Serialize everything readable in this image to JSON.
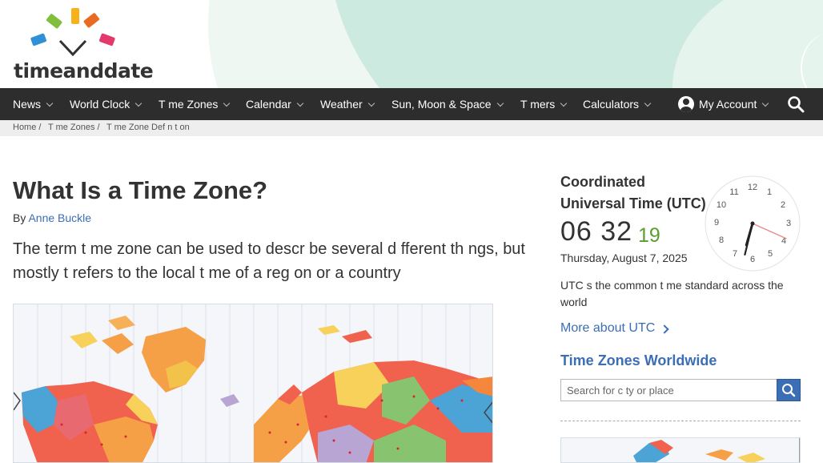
{
  "logo": {
    "text": "timeanddate",
    "colors": [
      "#f7b21b",
      "#e96a24",
      "#e33a6b",
      "#2f90d6",
      "#7fbf3c"
    ]
  },
  "nav": {
    "items": [
      {
        "label": "News"
      },
      {
        "label": "World Clock"
      },
      {
        "label": "T me Zones"
      },
      {
        "label": "Calendar"
      },
      {
        "label": "Weather"
      },
      {
        "label": "Sun, Moon & Space"
      },
      {
        "label": "T mers"
      },
      {
        "label": "Calculators"
      }
    ],
    "account": "My Account",
    "search_icon": "search-icon"
  },
  "breadcrumb": {
    "items": [
      "Home /",
      "T me Zones /",
      "T me Zone Def n t on"
    ]
  },
  "article": {
    "title": "What Is a Time Zone?",
    "by": "By",
    "author": "Anne Buckle",
    "lead": "The term t me zone can be used to descr be several d fferent th ngs, but mostly  t refers to the local t me of a reg on or a country"
  },
  "sidebar": {
    "utc_title": "Coordinated Universal Time (UTC)",
    "time_hm": "06 32",
    "time_sec": "19",
    "date": "Thursday, August 7, 2025",
    "desc": "UTC  s the common t me standard across the world",
    "more_link": "More about UTC",
    "worldwide_title": "Time Zones Worldwide",
    "search_placeholder": "Search for c ty or place",
    "clock": {
      "numbers": [
        "12",
        "1",
        "2",
        "3",
        "4",
        "5",
        "6",
        "7",
        "8",
        "9",
        "10",
        "11"
      ],
      "hour": 6,
      "minute": 32,
      "second": 19
    }
  },
  "colors": {
    "nav_bg": "#2d2d2d",
    "link": "#3b6eb4",
    "seconds": "#5a9e2f",
    "second_hand": "#e88a8a"
  }
}
